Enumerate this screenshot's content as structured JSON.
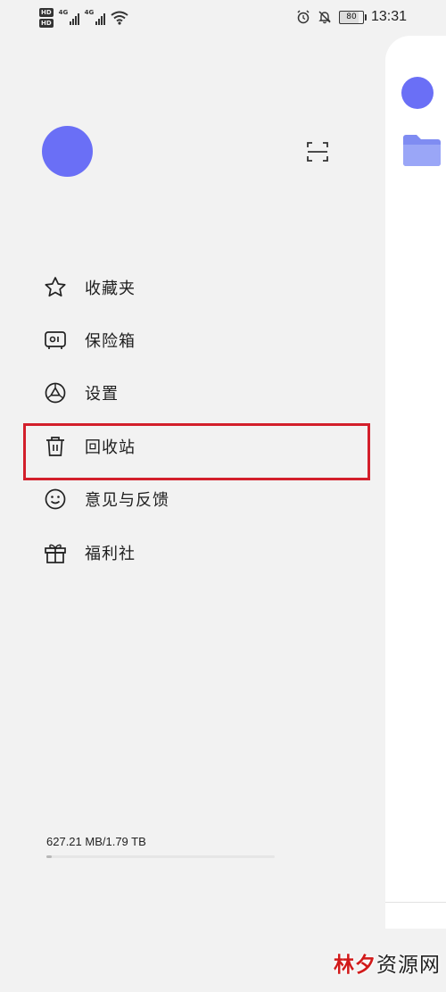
{
  "status_bar": {
    "hd_top": "HD",
    "hd_bottom": "HD",
    "net1": "4G",
    "net2": "4G",
    "battery": "80",
    "time": "13:31"
  },
  "menu": {
    "items": [
      {
        "label": "收藏夹",
        "icon": "star-icon"
      },
      {
        "label": "保险箱",
        "icon": "safe-icon"
      },
      {
        "label": "设置",
        "icon": "settings-icon"
      },
      {
        "label": "回收站",
        "icon": "trash-icon"
      },
      {
        "label": "意见与反馈",
        "icon": "smile-icon"
      },
      {
        "label": "福利社",
        "icon": "gift-icon"
      }
    ],
    "highlighted_item": "回收站",
    "highlight_color": "#d31f2b"
  },
  "storage": {
    "text": "627.21 MB/1.79 TB",
    "used_fraction": 0.0003
  },
  "watermark": {
    "part1": "林夕",
    "part2": "资源网"
  },
  "colors": {
    "accent": "#6a6ff6",
    "background": "#f2f2f2"
  }
}
